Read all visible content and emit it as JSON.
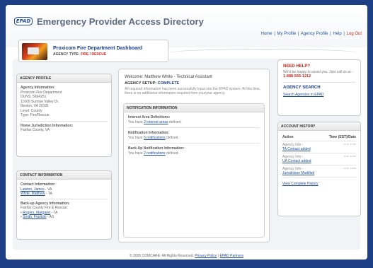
{
  "app": {
    "logo_text": "EPAD",
    "title": "Emergency Provider Access Directory"
  },
  "topnav": {
    "items": [
      "Home",
      "My Profile",
      "Agency Profile",
      "Help"
    ],
    "logout": "Log Out",
    "separator": "|"
  },
  "dashboard": {
    "title": "Proxicom Fire Department Dashboard",
    "agency_type_label": "AGENCY TYPE:",
    "agency_type_value": "FIRE / RESCUE"
  },
  "agency_profile": {
    "heading": "AGENCY PROFILE",
    "info_label": "Agency Information:",
    "info_lines": [
      "Proxicom Fire Department",
      "DUNS: 5664251",
      "11600 Sunrise Valley Dr.",
      "Reston, VA 20191",
      "Level: County",
      "Type: Fire/Rescue"
    ],
    "home_label": "Home Jurisdiction Information:",
    "home_value": "Fairfax County, VA"
  },
  "contact": {
    "heading": "CONTACT INFORMATION",
    "contact_label": "Contact Information:",
    "contacts": [
      {
        "name": "Lawton, James",
        "suffix": " - VA"
      },
      {
        "name": "White, Matthew",
        "suffix": " - TA"
      }
    ],
    "backup_label": "Back-up Agency Information:",
    "backup_agency": "Fairfax County Fire & Rescue:",
    "backups": [
      {
        "bullet": "•",
        "name": "Rogers, Margaret",
        "suffix": " - TA"
      },
      {
        "bullet": "•",
        "name": "Smith, Franklin",
        "suffix": " - AS"
      }
    ]
  },
  "center": {
    "welcome": "Welcome: Matthew White - Technical Assistant",
    "setup_label": "AGENCY SETUP:",
    "setup_status": "COMPLETE",
    "setup_desc": "All required information has been successfully input into the EPAD system. At this time, there is no additional information required from you/your agency.",
    "notifications": {
      "heading": "NOTIFICATION INFORMATION",
      "items": [
        {
          "label": "Interest Area Definitions:",
          "pre": "You have ",
          "link": "2 interest areas",
          "post": " defined."
        },
        {
          "label": "Notification Information:",
          "pre": "You have ",
          "link": "5 notifications",
          "post": " defined."
        },
        {
          "label": "Back-Up Notification Information:",
          "pre": "You have ",
          "link": "2 notifications",
          "post": " defined."
        }
      ]
    }
  },
  "help": {
    "heading": "NEED HELP?",
    "text": "We'd be happy to assist you. Just call us at -",
    "phone": "1-888-555-1212",
    "search_heading": "AGENCY SEARCH",
    "search_link": "Search Agencies in EPAD"
  },
  "history": {
    "heading": "ACCOUNT HISTORY",
    "col_action": "Action",
    "col_time": "Time (EST)/Date",
    "rows": [
      {
        "action": "Agency Info -",
        "link": "TA Contact added",
        "time": "11:22",
        "date": "1/7/05"
      },
      {
        "action": "Agency Info -",
        "link": "UA Contact added",
        "time": "11:06",
        "date": "1/7/05"
      },
      {
        "action": "Agency Info -",
        "link": "Jurisdiction Modified",
        "time": "14:27",
        "date": "1/6/05"
      }
    ],
    "view_link": "View Complete History"
  },
  "footer": {
    "text": "© 2005 COMCARE. All Rights Reserved. ",
    "privacy": "Privacy Policy",
    "sep": " | ",
    "partners": "EPAD Partners"
  },
  "colors": {
    "brand_blue": "#1a3c8c",
    "accent_red": "#c8261e",
    "background": "#1e3f85"
  }
}
